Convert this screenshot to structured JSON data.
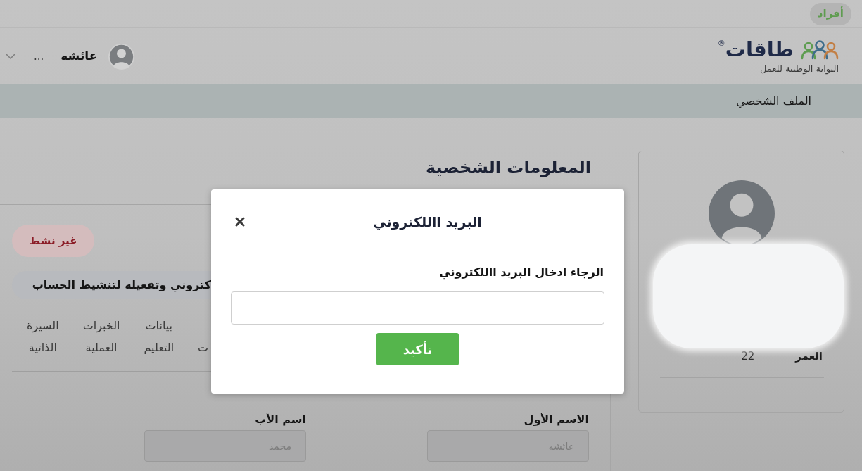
{
  "top_bar": {
    "portal_tabs": [
      {
        "label": "أفراد",
        "selected": true
      }
    ]
  },
  "header": {
    "logo": {
      "wordmark": "طاقات",
      "registered_mark": "®",
      "tagline": "البوابة الوطنية للعمل"
    },
    "user_menu": {
      "name": "عائشه",
      "more": "..."
    }
  },
  "nav": {
    "items": [
      {
        "label": "الملف الشخصي"
      }
    ]
  },
  "profile_card": {
    "age_label": "العمر",
    "age_value": "22"
  },
  "personal_info": {
    "title": "المعلومات الشخصية",
    "status_badge": "غير نشط",
    "notice": "كتروني وتفعيله لتنشيط الحساب",
    "tabs": [
      {
        "label": "ت"
      },
      {
        "label": "بيانات التعليم"
      },
      {
        "label": "الخبرات العملية"
      },
      {
        "label": "السيرة الذاتية"
      }
    ],
    "fields": [
      {
        "label": "الاسم الأول",
        "value": "عائشه",
        "disabled": true
      },
      {
        "label": "اسم الأب",
        "value": "محمد",
        "disabled": true
      }
    ]
  },
  "dialog": {
    "title": "البريد االلكتروني",
    "prompt": "الرجاء ادخال البريد االلكتروني",
    "confirm_button": "تأكيد"
  }
}
